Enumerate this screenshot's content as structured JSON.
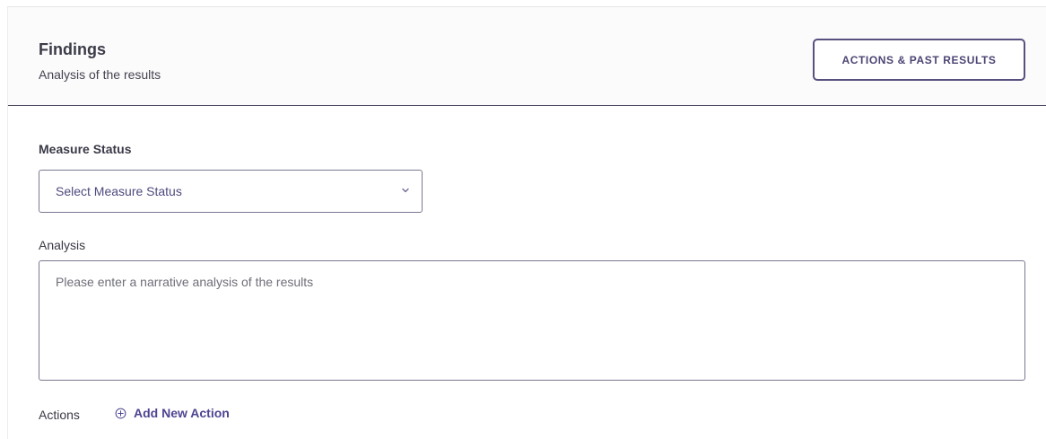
{
  "header": {
    "title": "Findings",
    "subtitle": "Analysis of the results",
    "actions_button_label": "ACTIONS & PAST RESULTS"
  },
  "measure_status": {
    "label": "Measure Status",
    "selected_value": "Select Measure Status"
  },
  "analysis": {
    "label": "Analysis",
    "placeholder": "Please enter a narrative analysis of the results",
    "value": ""
  },
  "actions": {
    "label": "Actions",
    "add_label": "Add New Action"
  },
  "colors": {
    "accent": "#4d4591",
    "button_border": "#58507f",
    "divider": "#4b4860"
  },
  "icons": {
    "dropdown": "chevron-down-icon",
    "add": "plus-circle-icon"
  }
}
